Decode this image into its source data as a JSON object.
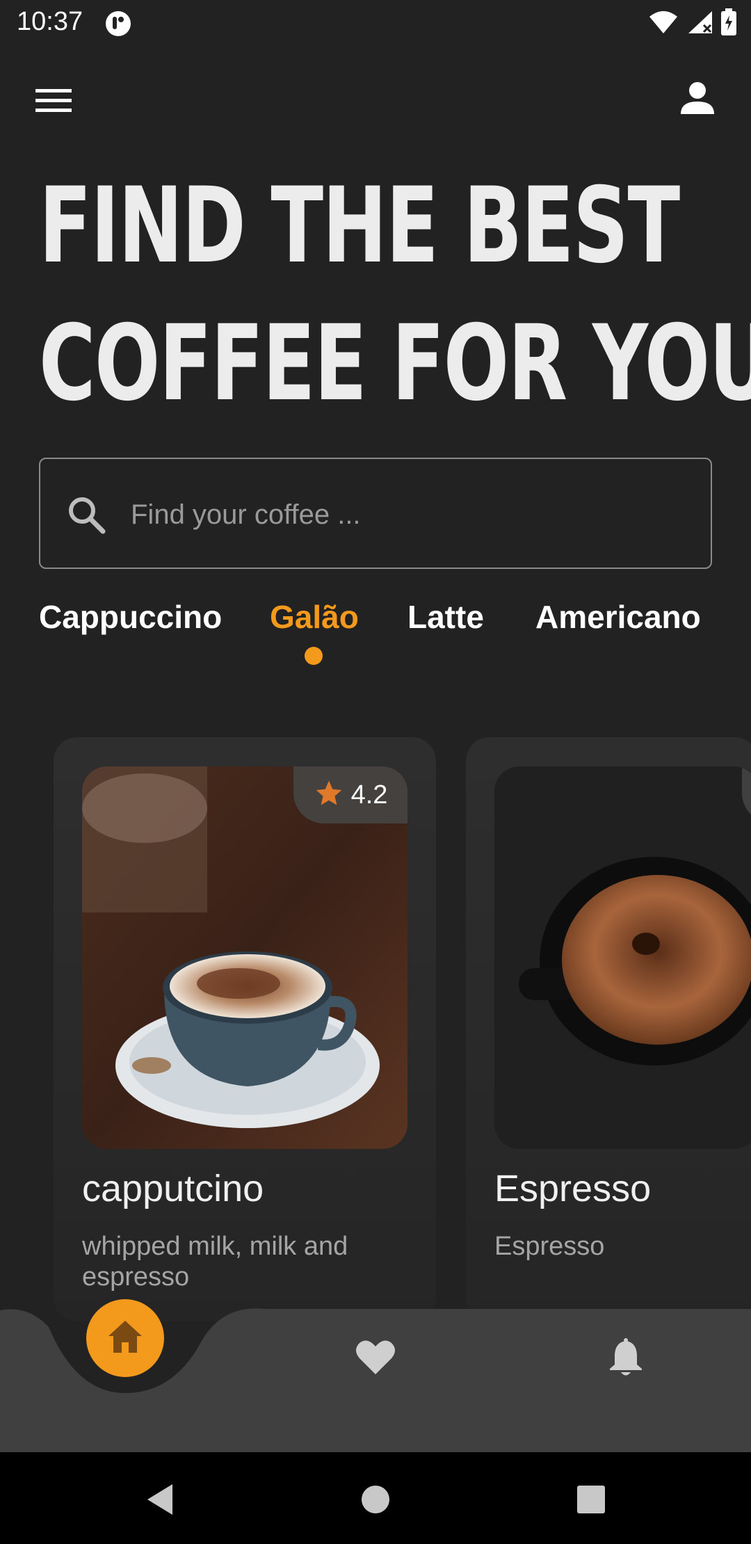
{
  "status_bar": {
    "time": "10:37",
    "icons": [
      "app-notification-icon",
      "wifi-icon",
      "signal-icon",
      "battery-icon"
    ]
  },
  "app_bar": {
    "menu_icon": "hamburger-menu-icon",
    "profile_icon": "person-icon"
  },
  "headline": {
    "line1": "FIND THE BEST",
    "line2": "COFFEE FOR YOU"
  },
  "search": {
    "placeholder": "Find your coffee ...",
    "value": ""
  },
  "tabs": [
    {
      "label": "Cappuccino",
      "active": false
    },
    {
      "label": "Galão",
      "active": true
    },
    {
      "label": "Latte",
      "active": false
    },
    {
      "label": "Americano",
      "active": false
    }
  ],
  "cards": [
    {
      "title": "capputcino",
      "description": "whipped milk, milk and espresso",
      "rating": "4.2"
    },
    {
      "title": "Espresso",
      "description": "Espresso",
      "rating": ""
    }
  ],
  "bottom_nav": {
    "items": [
      "home-icon",
      "heart-icon",
      "bell-icon"
    ],
    "active": "home"
  },
  "colors": {
    "background": "#222222",
    "accent": "#f39a1d",
    "card": "#2e2e2e",
    "nav_bar": "#3f3f3f"
  }
}
